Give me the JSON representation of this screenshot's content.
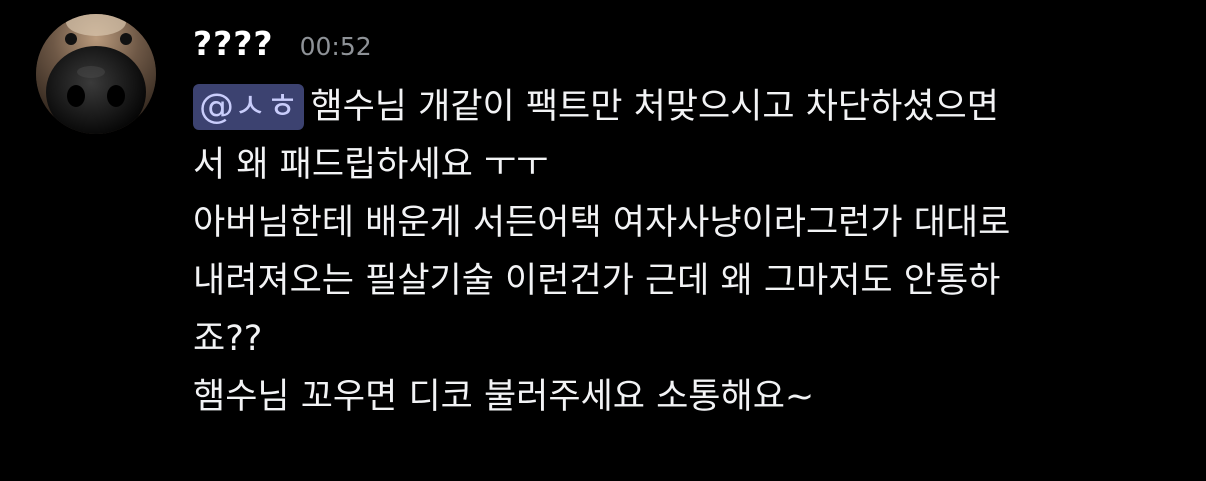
{
  "message": {
    "username": "????",
    "timestamp": "00:52",
    "mention": "@ㅅㅎ",
    "lines": [
      "햄수님 개같이 팩트만 처맞으시고 차단하셨으면",
      "서 왜 패드립하세요 ㅜㅜ",
      "아버님한테 배운게 서든어택 여자사냥이라그런가 대대로",
      "내려져오는 필살기술 이런건가 근데 왜 그마저도 안통하",
      "죠??",
      "햄수님 꼬우면 디코 불러주세요 소통해요~"
    ]
  },
  "colors": {
    "background": "#000000",
    "mention_bg": "#3c4270",
    "mention_text": "#c9cdfb",
    "timestamp": "#8e9297"
  },
  "icons": {
    "avatar": "dog-nose-avatar"
  }
}
